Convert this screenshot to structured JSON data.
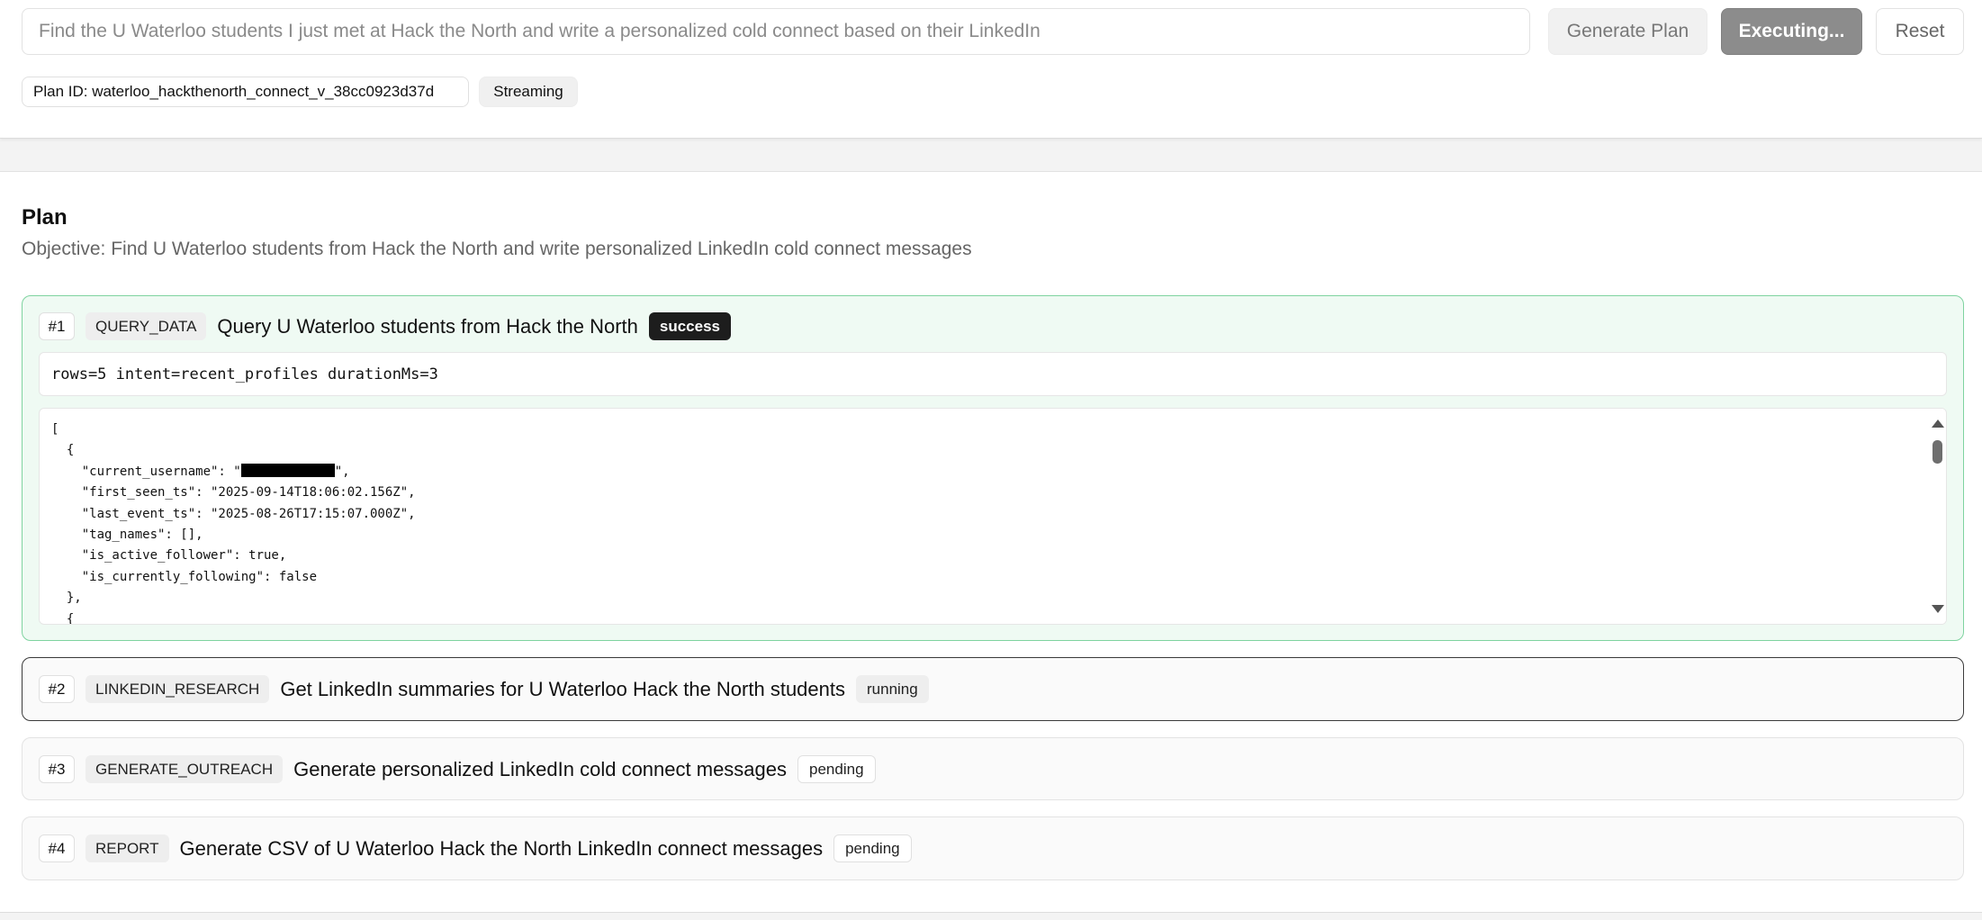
{
  "query": {
    "placeholder": "Find the U Waterloo students I just met at Hack the North and write a personalized cold connect based on their LinkedIn",
    "value": ""
  },
  "toolbar": {
    "generate_label": "Generate Plan",
    "executing_label": "Executing...",
    "reset_label": "Reset"
  },
  "meta": {
    "plan_id": "Plan ID: waterloo_hackthenorth_connect_v_38cc0923d37d",
    "mode": "Streaming"
  },
  "plan": {
    "heading": "Plan",
    "objective": "Objective: Find U Waterloo students from Hack the North and write personalized LinkedIn cold connect messages",
    "steps": [
      {
        "num": "#1",
        "type": "QUERY_DATA",
        "title": "Query U Waterloo students from Hack the North",
        "status": "success",
        "summary": "rows=5 intent=recent_profiles durationMs=3",
        "json": {
          "l1": "[",
          "l2": "  {",
          "l3_pre": "    \"current_username\": \"",
          "l3_post": "\",",
          "l4": "    \"first_seen_ts\": \"2025-09-14T18:06:02.156Z\",",
          "l5": "    \"last_event_ts\": \"2025-08-26T17:15:07.000Z\",",
          "l6": "    \"tag_names\": [],",
          "l7": "    \"is_active_follower\": true,",
          "l8": "    \"is_currently_following\": false",
          "l9": "  },",
          "l10": "  {"
        }
      },
      {
        "num": "#2",
        "type": "LINKEDIN_RESEARCH",
        "title": "Get LinkedIn summaries for U Waterloo Hack the North students",
        "status": "running"
      },
      {
        "num": "#3",
        "type": "GENERATE_OUTREACH",
        "title": "Generate personalized LinkedIn cold connect messages",
        "status": "pending"
      },
      {
        "num": "#4",
        "type": "REPORT",
        "title": "Generate CSV of U Waterloo Hack the North LinkedIn connect messages",
        "status": "pending"
      }
    ]
  },
  "colors": {
    "success_bg": "#effaf3",
    "success_border": "#7fd3a0",
    "running_border": "#3b3b3b",
    "executing_button": "#8c8c8c"
  },
  "icons": {
    "scroll_up": "triangle-up-icon",
    "scroll_down": "triangle-down-icon"
  }
}
